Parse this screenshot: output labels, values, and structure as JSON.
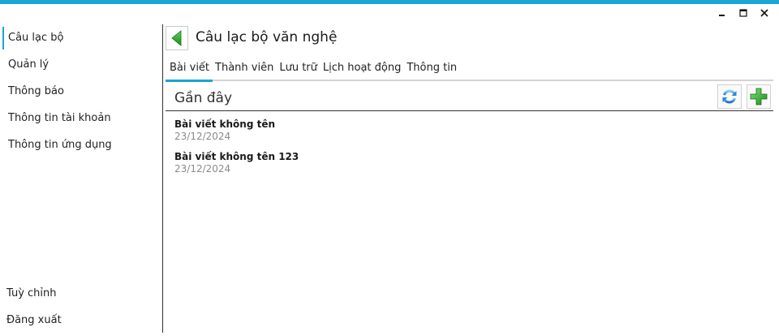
{
  "window": {
    "accent": "#17a6d5",
    "controls": [
      "minimize-icon",
      "maximize-icon",
      "close-icon"
    ]
  },
  "sidebar": {
    "items": [
      {
        "label": "Câu lạc bộ",
        "active": true
      },
      {
        "label": "Quản lý"
      },
      {
        "label": "Thông báo"
      },
      {
        "label": "Thông tin tài khoản"
      },
      {
        "label": "Thông tin ứng dụng"
      }
    ],
    "bottom_items": [
      {
        "label": "Tuỳ chỉnh"
      },
      {
        "label": "Đăng xuất"
      }
    ]
  },
  "header": {
    "title": "Câu lạc bộ văn nghệ",
    "back_icon": "back-arrow-icon"
  },
  "tabs": [
    {
      "label": "Bài viết",
      "active": true
    },
    {
      "label": "Thành viên"
    },
    {
      "label": "Lưu trữ"
    },
    {
      "label": "Lịch hoạt động"
    },
    {
      "label": "Thông tin"
    }
  ],
  "section": {
    "title": "Gần đây",
    "actions": [
      "refresh-icon",
      "add-icon"
    ]
  },
  "posts": [
    {
      "title": "Bài viết không tên",
      "date": "23/12/2024"
    },
    {
      "title": "Bài viết không tên 123",
      "date": "23/12/2024"
    }
  ]
}
